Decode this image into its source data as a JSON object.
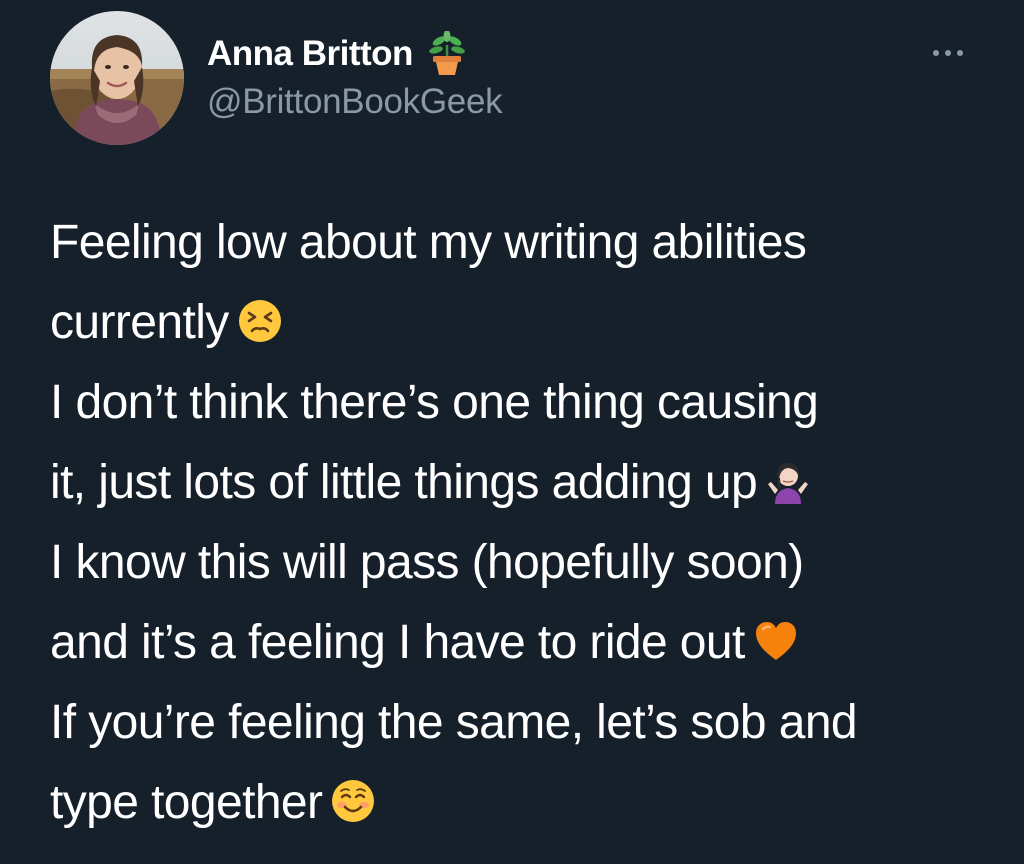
{
  "tweet": {
    "author": {
      "display_name": "Anna Britton",
      "handle": "@BrittonBookGeek",
      "name_emoji": "potted-plant-icon"
    },
    "body_lines": [
      "Feeling low about my writing abilities",
      "currently",
      "I don’t think there’s one thing causing",
      "it, just lots of little things adding up",
      "I know this will pass (hopefully soon)",
      "and it’s a feeling I have to ride out",
      "If you’re feeling the same, let’s sob and",
      "type together"
    ],
    "emojis": {
      "line_2": "persevering-face-icon",
      "line_4": "person-shrugging-icon",
      "line_6": "orange-heart-icon",
      "line_8": "smiling-face-icon"
    }
  },
  "colors": {
    "background": "#15202b",
    "text": "#ffffff",
    "secondary_text": "#8b98a5"
  }
}
